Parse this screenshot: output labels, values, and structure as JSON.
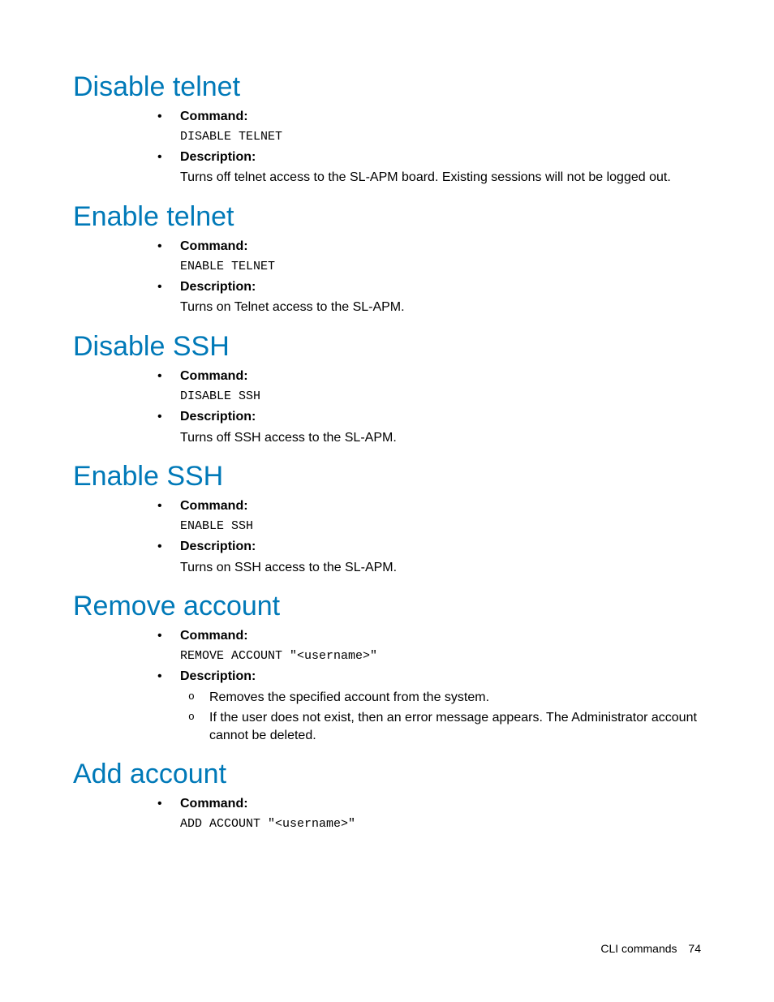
{
  "sections": [
    {
      "heading": "Disable telnet",
      "items": [
        {
          "label": "Command:",
          "code": "DISABLE TELNET"
        },
        {
          "label": "Description:",
          "text": "Turns off telnet access to the SL-APM board. Existing sessions will not be logged out."
        }
      ]
    },
    {
      "heading": "Enable telnet",
      "items": [
        {
          "label": "Command:",
          "code": "ENABLE TELNET"
        },
        {
          "label": "Description:",
          "text": "Turns on Telnet access to the SL-APM."
        }
      ]
    },
    {
      "heading": "Disable SSH",
      "items": [
        {
          "label": "Command:",
          "code": "DISABLE SSH"
        },
        {
          "label": "Description:",
          "text": "Turns off SSH access to the SL-APM."
        }
      ]
    },
    {
      "heading": "Enable SSH",
      "items": [
        {
          "label": "Command:",
          "code": "ENABLE SSH"
        },
        {
          "label": "Description:",
          "text": "Turns on SSH access to the SL-APM."
        }
      ]
    },
    {
      "heading": "Remove account",
      "items": [
        {
          "label": "Command:",
          "code": "REMOVE ACCOUNT \"<username>\""
        },
        {
          "label": "Description:",
          "sub": [
            "Removes the specified account from the system.",
            "If the user does not exist, then an error message appears. The Administrator account cannot be deleted."
          ]
        }
      ]
    },
    {
      "heading": "Add account",
      "items": [
        {
          "label": "Command:",
          "code": "ADD ACCOUNT \"<username>\""
        }
      ]
    }
  ],
  "footer": {
    "label": "CLI commands",
    "page": "74"
  }
}
